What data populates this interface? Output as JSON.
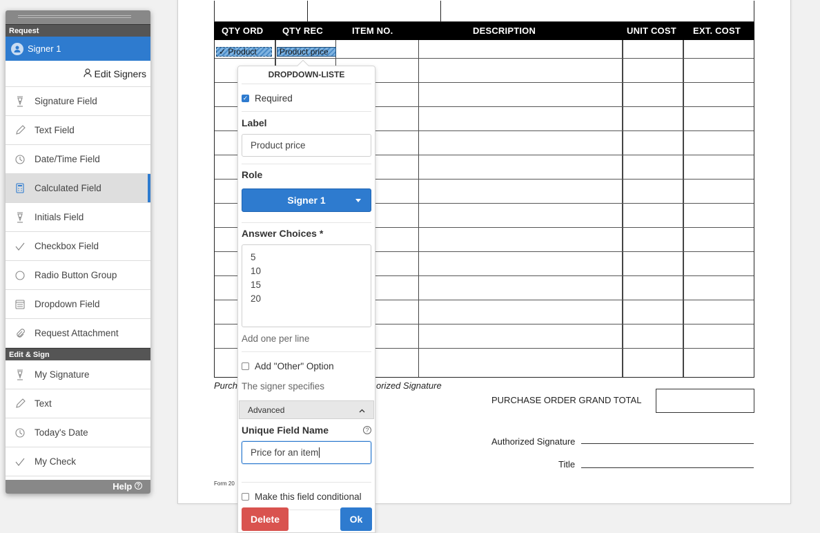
{
  "document": {
    "columns": [
      "QTY ORD",
      "QTY REC",
      "ITEM NO.",
      "DESCRIPTION",
      "UNIT COST",
      "EXT. COST"
    ],
    "footer_left": "Purch",
    "footer_mid": "orized Signature",
    "grand_total_label": "PURCHASE ORDER GRAND TOTAL",
    "authorized_signature_label": "Authorized Signature",
    "title_label": "Title",
    "form_note": "Form 20"
  },
  "placed_fields": {
    "product": "✓ Product",
    "product_price": "Product price"
  },
  "panel": {
    "request_header": "Request",
    "signer_label": "Signer 1",
    "edit_signers": "Edit Signers",
    "request_tools": [
      {
        "label": "Signature Field",
        "icon": "pen-nib-icon"
      },
      {
        "label": "Text Field",
        "icon": "pencil-icon"
      },
      {
        "label": "Date/Time Field",
        "icon": "clock-icon"
      },
      {
        "label": "Calculated Field",
        "icon": "calculator-icon"
      },
      {
        "label": "Initials Field",
        "icon": "pen-nib-icon"
      },
      {
        "label": "Checkbox Field",
        "icon": "checkmark-icon"
      },
      {
        "label": "Radio Button Group",
        "icon": "radio-icon"
      },
      {
        "label": "Dropdown Field",
        "icon": "dropdown-icon"
      },
      {
        "label": "Request Attachment",
        "icon": "paperclip-icon"
      }
    ],
    "edit_sign_header": "Edit & Sign",
    "edit_tools": [
      {
        "label": "My Signature",
        "icon": "pen-nib-icon"
      },
      {
        "label": "Text",
        "icon": "pencil-icon"
      },
      {
        "label": "Today's Date",
        "icon": "clock-icon"
      },
      {
        "label": "My Check",
        "icon": "checkmark-icon"
      }
    ],
    "help_label": "Help"
  },
  "popover": {
    "title": "DROPDOWN-LISTE",
    "required_label": "Required",
    "required_checked": true,
    "label_heading": "Label",
    "label_value": "Product price",
    "role_heading": "Role",
    "role_value": "Signer 1",
    "answer_heading": "Answer Choices *",
    "answer_choices": "5\n10\n15\n20",
    "answer_hint": "Add one per line",
    "other_option_label": "Add \"Other\" Option",
    "other_option_hint": "The signer specifies",
    "advanced_label": "Advanced",
    "unique_name_heading": "Unique Field Name",
    "unique_name_value": "Price for an item",
    "conditional_label": "Make this field conditional",
    "delete_label": "Delete",
    "ok_label": "Ok"
  }
}
